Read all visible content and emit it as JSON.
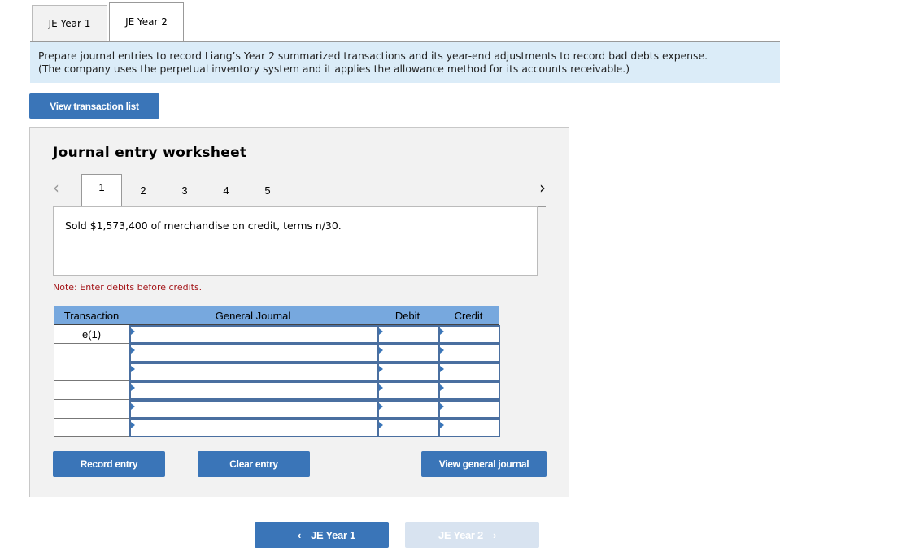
{
  "tabs": [
    {
      "label": "JE Year 1",
      "active": false
    },
    {
      "label": "JE Year 2",
      "active": true
    }
  ],
  "instructions": {
    "line1": "Prepare journal entries to record Liang’s Year 2 summarized transactions and its year-end adjustments to record bad debts expense.",
    "line2": "(The company uses the perpetual inventory system and it applies the allowance method for its accounts receivable.)"
  },
  "view_transaction_list_label": "View transaction list",
  "worksheet": {
    "title": "Journal entry worksheet",
    "prev_icon": "chevron-left-icon",
    "next_icon": "chevron-right-icon",
    "pages": [
      "1",
      "2",
      "3",
      "4",
      "5"
    ],
    "active_page": "1",
    "description": "Sold $1,573,400 of merchandise on credit, terms n/30.",
    "note": "Note: Enter debits before credits.",
    "table": {
      "headers": {
        "transaction": "Transaction",
        "general_journal": "General Journal",
        "debit": "Debit",
        "credit": "Credit"
      },
      "rows": [
        {
          "transaction": "e(1)",
          "account": "",
          "debit": "",
          "credit": ""
        },
        {
          "transaction": "",
          "account": "",
          "debit": "",
          "credit": ""
        },
        {
          "transaction": "",
          "account": "",
          "debit": "",
          "credit": ""
        },
        {
          "transaction": "",
          "account": "",
          "debit": "",
          "credit": ""
        },
        {
          "transaction": "",
          "account": "",
          "debit": "",
          "credit": ""
        },
        {
          "transaction": "",
          "account": "",
          "debit": "",
          "credit": ""
        }
      ]
    },
    "buttons": {
      "record": "Record entry",
      "clear": "Clear entry",
      "view_general_journal": "View general journal"
    }
  },
  "bottom_nav": {
    "prev_label": "JE Year 1",
    "next_label": "JE Year 2",
    "prev_chevron": "‹",
    "next_chevron": "›",
    "next_disabled": true
  },
  "colors": {
    "accent": "#3a75b8",
    "header_blue": "#77a8de",
    "instruction_bg": "#dbecf8",
    "note_red": "#a4161a",
    "disabled_button": "#d8e3f0"
  }
}
